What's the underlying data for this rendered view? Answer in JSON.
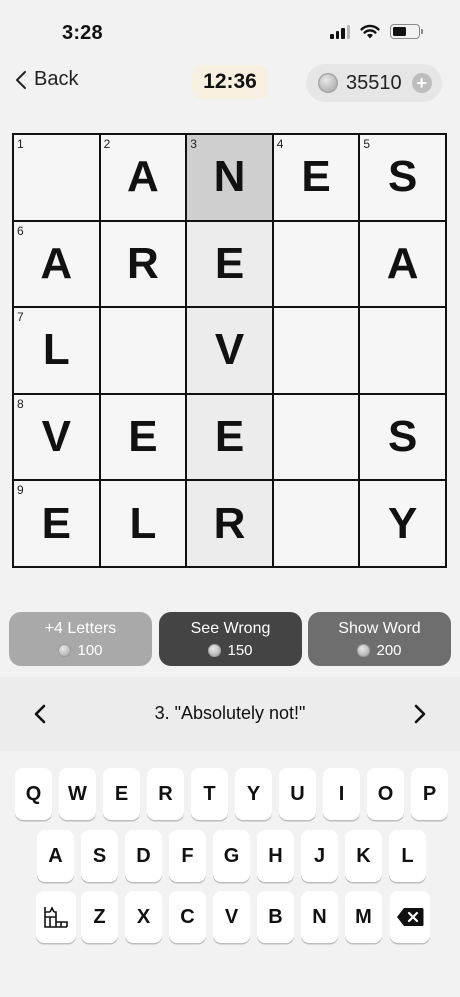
{
  "status": {
    "time": "3:28"
  },
  "nav": {
    "back_label": "Back",
    "timer": "12:36",
    "coins": "35510"
  },
  "grid": {
    "rows": [
      [
        {
          "num": "1",
          "letter": ""
        },
        {
          "num": "2",
          "letter": "A"
        },
        {
          "num": "3",
          "letter": "N"
        },
        {
          "num": "4",
          "letter": "E"
        },
        {
          "num": "5",
          "letter": "S"
        }
      ],
      [
        {
          "num": "6",
          "letter": "A"
        },
        {
          "num": "",
          "letter": "R"
        },
        {
          "num": "",
          "letter": "E"
        },
        {
          "num": "",
          "letter": ""
        },
        {
          "num": "",
          "letter": "A"
        }
      ],
      [
        {
          "num": "7",
          "letter": "L"
        },
        {
          "num": "",
          "letter": ""
        },
        {
          "num": "",
          "letter": "V"
        },
        {
          "num": "",
          "letter": ""
        },
        {
          "num": "",
          "letter": ""
        }
      ],
      [
        {
          "num": "8",
          "letter": "V"
        },
        {
          "num": "",
          "letter": "E"
        },
        {
          "num": "",
          "letter": "E"
        },
        {
          "num": "",
          "letter": ""
        },
        {
          "num": "",
          "letter": "S"
        }
      ],
      [
        {
          "num": "9",
          "letter": "E"
        },
        {
          "num": "",
          "letter": "L"
        },
        {
          "num": "",
          "letter": "R"
        },
        {
          "num": "",
          "letter": ""
        },
        {
          "num": "",
          "letter": "Y"
        }
      ]
    ],
    "highlight_column": 2,
    "selected_cell": [
      0,
      2
    ]
  },
  "hints": [
    {
      "label": "+4 Letters",
      "cost": "100"
    },
    {
      "label": "See Wrong",
      "cost": "150"
    },
    {
      "label": "Show Word",
      "cost": "200"
    }
  ],
  "clue": {
    "text": "3. \"Absolutely not!\""
  },
  "keyboard": {
    "row1": [
      "Q",
      "W",
      "E",
      "R",
      "T",
      "Y",
      "U",
      "I",
      "O",
      "P"
    ],
    "row2": [
      "A",
      "S",
      "D",
      "F",
      "G",
      "H",
      "J",
      "K",
      "L"
    ],
    "row3": [
      "Z",
      "X",
      "C",
      "V",
      "B",
      "N",
      "M"
    ],
    "left_icon": "grid-layout-icon",
    "right_icon": "backspace-icon"
  },
  "colors": {
    "selected_cell": "#cfcfcf",
    "highlight_cell": "#ececec",
    "timer_bg": "#f7efdf"
  }
}
